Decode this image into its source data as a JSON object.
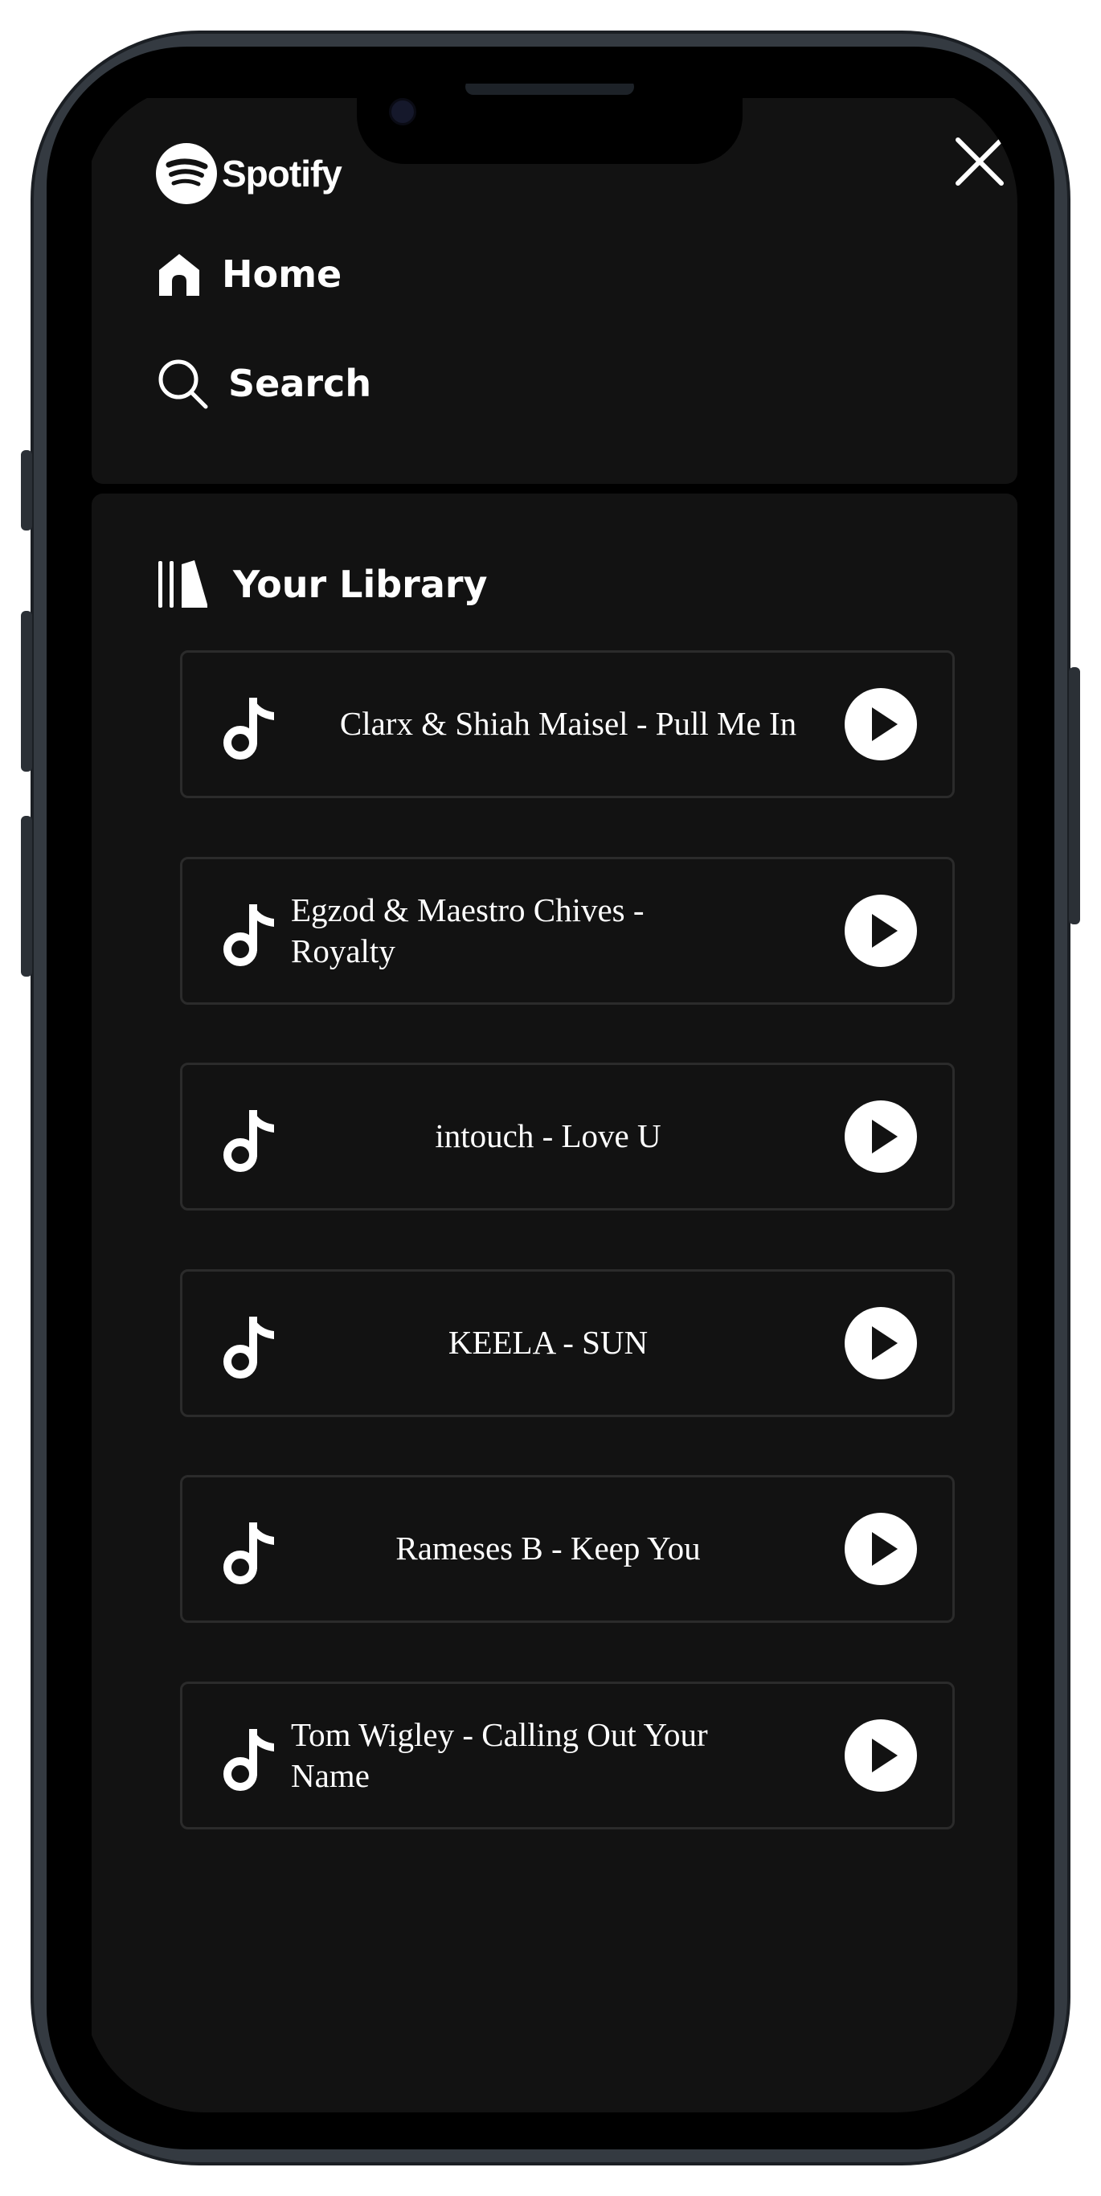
{
  "app": {
    "brand_name": "Spotify"
  },
  "nav": {
    "home_label": "Home",
    "search_label": "Search"
  },
  "library": {
    "title": "Your Library",
    "tracks": [
      {
        "title": "Clarx & Shiah Maisel - Pull Me In"
      },
      {
        "title": "Egzod & Maestro Chives - Royalty"
      },
      {
        "title": "intouch - Love U"
      },
      {
        "title": "KEELA - SUN"
      },
      {
        "title": "Rameses B - Keep You"
      },
      {
        "title": "Tom Wigley - Calling Out Your Name"
      }
    ]
  },
  "theme": {
    "background": "#000000",
    "panel": "#121212",
    "text": "#ffffff",
    "card_border": "#2b2b2b"
  },
  "icons": {
    "close": "close-icon",
    "home": "home-icon",
    "search": "search-icon",
    "library": "library-icon",
    "track": "music-note-icon",
    "play": "play-icon"
  }
}
